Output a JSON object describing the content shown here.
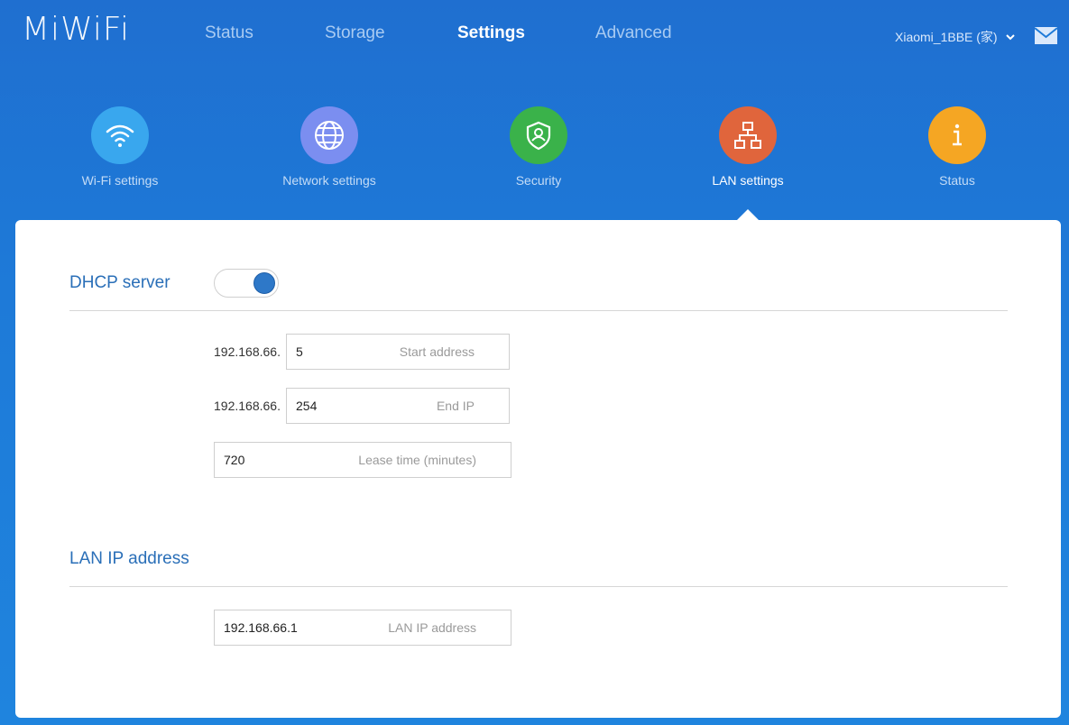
{
  "header": {
    "logo": "MiWiFi",
    "nav": [
      {
        "label": "Status"
      },
      {
        "label": "Storage"
      },
      {
        "label": "Settings"
      },
      {
        "label": "Advanced"
      }
    ],
    "router_name": "Xiaomi_1BBE (家)"
  },
  "categories": [
    {
      "label": "Wi-Fi settings",
      "icon": "wifi-icon",
      "color": "#39a7ee"
    },
    {
      "label": "Network settings",
      "icon": "globe-icon",
      "color": "#7b8ef0"
    },
    {
      "label": "Security",
      "icon": "shield-icon",
      "color": "#3ab24a"
    },
    {
      "label": "LAN settings",
      "icon": "network-tree-icon",
      "color": "#e0653c"
    },
    {
      "label": "Status",
      "icon": "info-icon",
      "color": "#f5a623"
    }
  ],
  "dhcp": {
    "title": "DHCP server",
    "enabled": true,
    "prefix": "192.168.66.",
    "start": {
      "value": "5",
      "hint": "Start address"
    },
    "end": {
      "value": "254",
      "hint": "End IP"
    },
    "lease": {
      "value": "720",
      "hint": "Lease time (minutes)"
    }
  },
  "lan": {
    "title": "LAN IP address",
    "ip": {
      "value": "192.168.66.1",
      "hint": "LAN IP address"
    }
  },
  "colors": {
    "accent": "#2a6fb8",
    "header_bg": "#1e7ad8",
    "toggle_on": "#2e78c8"
  }
}
